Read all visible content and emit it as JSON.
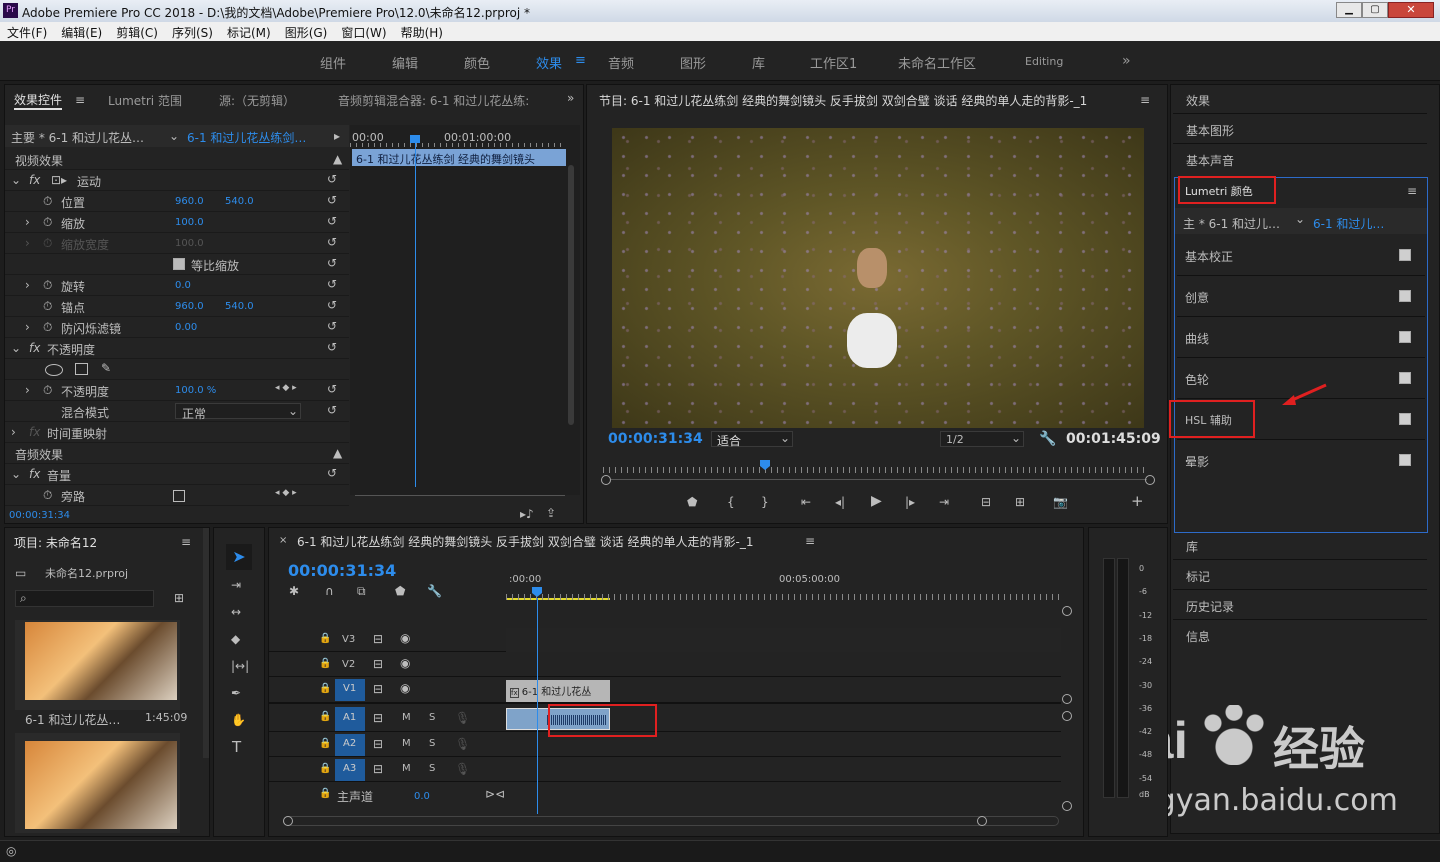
{
  "app": {
    "title": "Adobe Premiere Pro CC 2018 - D:\\我的文档\\Adobe\\Premiere Pro\\12.0\\未命名12.prproj *",
    "logo": "Pr"
  },
  "menu": [
    "文件(F)",
    "编辑(E)",
    "剪辑(C)",
    "序列(S)",
    "标记(M)",
    "图形(G)",
    "窗口(W)",
    "帮助(H)"
  ],
  "workspaces": [
    "组件",
    "编辑",
    "颜色",
    "效果",
    "音频",
    "图形",
    "库",
    "工作区1",
    "未命名工作区",
    "Editing"
  ],
  "effect_controls": {
    "tabs": [
      "效果控件",
      "Lumetri 范围",
      "源:（无剪辑）",
      "音频剪辑混合器: 6-1  和过儿花丛练:"
    ],
    "master": "主要 * 6-1 和过儿花丛…",
    "clip": "6-1  和过儿花丛练剑…",
    "timecodes": [
      "00:00",
      "00:01:00:00"
    ],
    "clip_bar": "6-1  和过儿花丛练剑 经典的舞剑镜头",
    "video_effects": "视频效果",
    "motion": "运动",
    "position": "位置",
    "pos_x": "960.0",
    "pos_y": "540.0",
    "scale": "缩放",
    "scale_val": "100.0",
    "scale_width": "缩放宽度",
    "scale_width_val": "100.0",
    "uniform": "等比缩放",
    "rotation": "旋转",
    "rotation_val": "0.0",
    "anchor": "锚点",
    "anchor_x": "960.0",
    "anchor_y": "540.0",
    "flicker": "防闪烁滤镜",
    "flicker_val": "0.00",
    "opacity_group": "不透明度",
    "opacity": "不透明度",
    "opacity_val": "100.0 %",
    "blend": "混合模式",
    "blend_val": "正常",
    "time_remap": "时间重映射",
    "audio_effects": "音频效果",
    "volume": "音量",
    "bypass": "旁路",
    "current_time": "00:00:31:34"
  },
  "program": {
    "title": "节目: 6-1  和过儿花丛练剑 经典的舞剑镜头 反手拔剑 双剑合璧 谈话 经典的单人走的背影-_1",
    "timecode": "00:00:31:34",
    "fit": "适合",
    "quality": "1/2",
    "duration": "00:01:45:09"
  },
  "right_panel": {
    "top_items": [
      "效果",
      "基本图形",
      "基本声音"
    ],
    "lumetri_title": "Lumetri 颜色",
    "master": "主 * 6-1 和过儿…",
    "clip": "6-1  和过儿…",
    "sections": [
      "基本校正",
      "创意",
      "曲线",
      "色轮",
      "HSL 辅助",
      "晕影"
    ],
    "bottom_items": [
      "库",
      "标记",
      "历史记录",
      "信息"
    ]
  },
  "project": {
    "title": "项目: 未命名12",
    "file": "未命名12.prproj",
    "clips": [
      {
        "name": "6-1 和过儿花丛…",
        "dur": "1:45:09"
      }
    ]
  },
  "timeline": {
    "title": "6-1  和过儿花丛练剑 经典的舞剑镜头 反手拔剑 双剑合璧 谈话 经典的单人走的背影-_1",
    "timecode": "00:00:31:34",
    "ruler": [
      ":00:00",
      "00:05:00:00"
    ],
    "tracks_v": [
      "V3",
      "V2",
      "V1"
    ],
    "tracks_a": [
      "A1",
      "A2",
      "A3"
    ],
    "master": "主声道",
    "master_val": "0.0",
    "clip_label": "6-1 和过儿花丛"
  },
  "meter": {
    "labels": [
      "0",
      "-6",
      "-12",
      "-18",
      "-24",
      "-30",
      "-36",
      "-42",
      "-48",
      "-54"
    ],
    "unit": "dB"
  },
  "watermark": {
    "text1": "Bai",
    "text2": "经验",
    "url": "jingyan.baidu.com"
  },
  "colors": {
    "accent": "#2d8ceb",
    "highlight": "#e02020"
  }
}
